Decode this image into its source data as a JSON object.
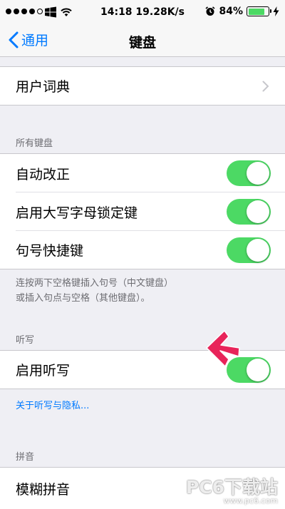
{
  "status_bar": {
    "time_speed": "14:18 19.28K/s",
    "battery_percent": "84%",
    "battery_level": 0.84,
    "signal_dots_filled": 4,
    "icons": [
      "signal-dots",
      "windows-logo",
      "wifi",
      "alarm-clock",
      "battery",
      "charging-bolt"
    ]
  },
  "nav": {
    "back_label": "通用",
    "title": "键盘"
  },
  "rows": {
    "user_dictionary": "用户词典",
    "auto_correct": "自动改正",
    "caps_lock": "启用大写字母锁定键",
    "period_shortcut": "句号快捷键",
    "enable_dictation": "启用听写",
    "fuzzy_pinyin": "模糊拼音"
  },
  "sections": {
    "all_keyboards": "所有键盘",
    "dictation": "听写",
    "pinyin": "拼音"
  },
  "footer": {
    "period_line1": "连按两下空格键插入句号（中文键盘）",
    "period_line2": "或插入句点与空格（其他键盘）。",
    "dictation_privacy_link": "关于听写与隐私..."
  },
  "toggles": {
    "auto_correct": true,
    "caps_lock": true,
    "period_shortcut": true,
    "enable_dictation": true
  },
  "colors": {
    "accent": "#007aff",
    "toggle_on": "#4cd964",
    "annotation_arrow": "#e8245a",
    "background": "#efeff4"
  },
  "watermark": {
    "brand": "PC6下载站",
    "url": "www.pc6.com"
  }
}
